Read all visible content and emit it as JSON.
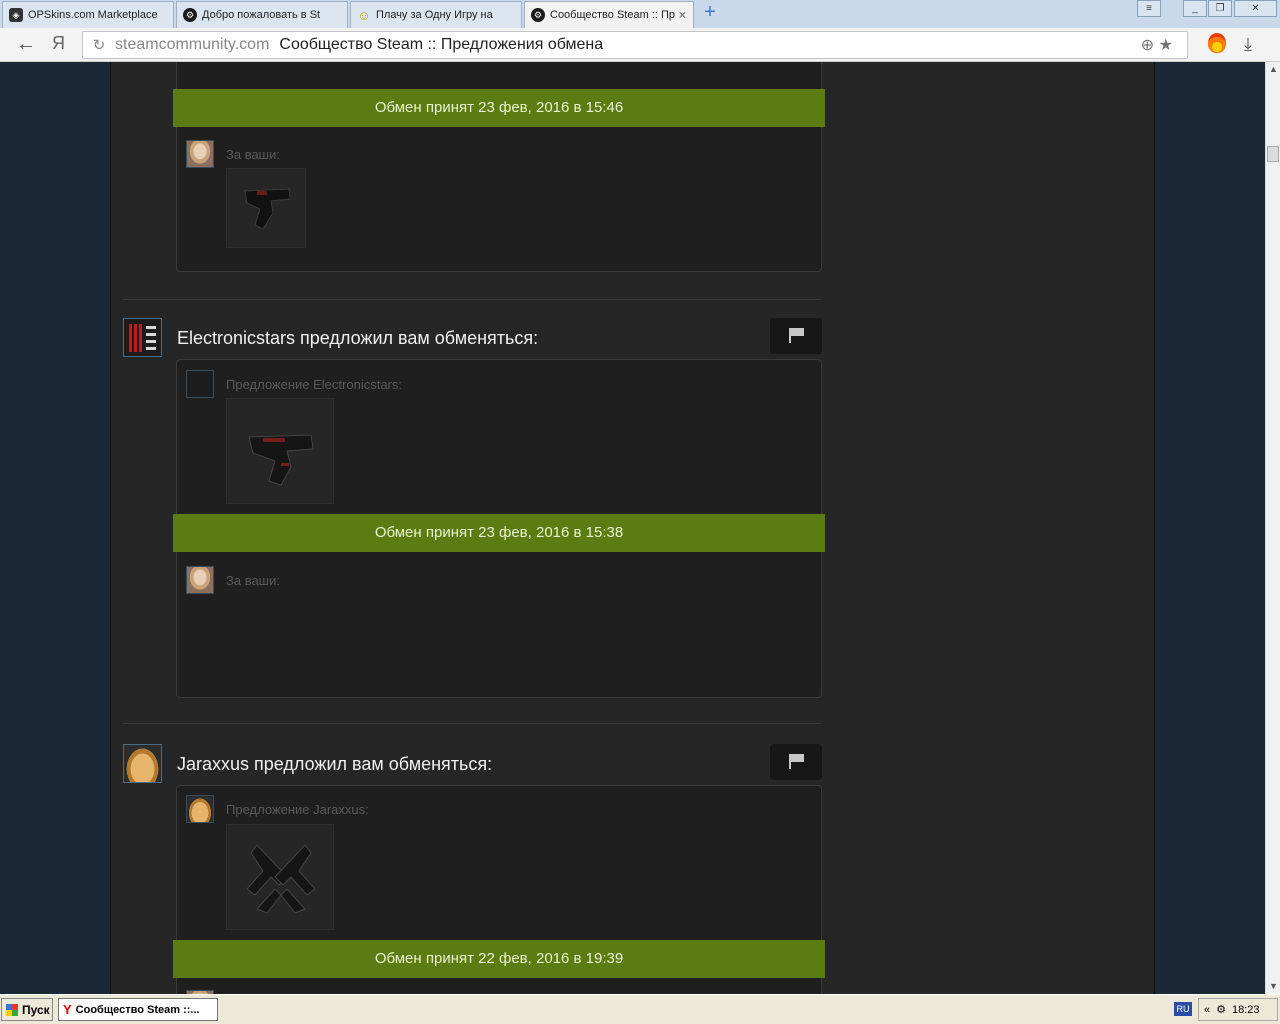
{
  "browser": {
    "tabs": [
      {
        "label": "OPSkins.com Marketplace",
        "icon": "opskins-icon"
      },
      {
        "label": "Добро пожаловать в St",
        "icon": "steam-icon"
      },
      {
        "label": "Плачу за Одну Игру на",
        "icon": "smile-icon"
      },
      {
        "label": "Сообщество Steam :: Пр",
        "icon": "steam-icon",
        "close": "✕"
      }
    ],
    "new_tab": "+",
    "address": {
      "domain": "steamcommunity.com",
      "title": "Сообщество Steam :: Предложения обмена"
    },
    "yandex_button": "Я"
  },
  "trades": [
    {
      "status": "Обмен принят 23 фев, 2016 в 15:46",
      "your_label": "За ваши:"
    },
    {
      "partner": "Electronicstars",
      "heading": "Electronicstars предложил вам обменяться:",
      "offer_label": "Предложение Electronicstars:",
      "status": "Обмен принят 23 фев, 2016 в 15:38",
      "your_label": "За ваши:"
    },
    {
      "partner": "Jaraxxus",
      "heading": "Jaraxxus предложил вам обменяться:",
      "offer_label": "Предложение Jaraxxus:",
      "status": "Обмен принят 22 фев, 2016 в 19:39"
    }
  ],
  "taskbar": {
    "start": "Пуск",
    "window": "Сообщество Steam ::...",
    "lang": "RU",
    "tray_chevron": "«",
    "time": "18:23"
  },
  "colors": {
    "accepted_bar": "#5b7c12",
    "page_bg": "#1b2838",
    "column_bg": "#262626"
  }
}
